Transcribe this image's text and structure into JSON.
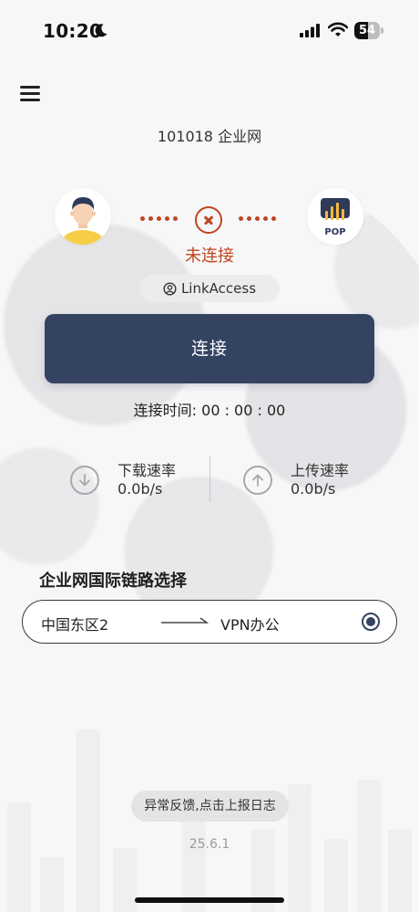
{
  "status_bar": {
    "time": "10:20",
    "battery_level": "54",
    "icons": [
      "moon-icon",
      "signal-icon",
      "wifi-icon",
      "battery-icon"
    ]
  },
  "header": {
    "title": "101018 企业网"
  },
  "connection": {
    "status": "未连接",
    "account": "LinkAccess",
    "pop_label": "POP",
    "button_label": "连接",
    "time_label": "连接时间: 00 : 00 : 00",
    "status_color": "#c0451f",
    "button_color": "#344362"
  },
  "speeds": {
    "download": {
      "label": "下载速率",
      "value": "0.0b/s"
    },
    "upload": {
      "label": "上传速率",
      "value": "0.0b/s"
    }
  },
  "route_section": {
    "title": "企业网国际链路选择",
    "route": {
      "from": "中国东区2",
      "to": "VPN办公",
      "selected": true
    }
  },
  "footer": {
    "feedback_label": "异常反馈,点击上报日志",
    "version": "25.6.1"
  }
}
